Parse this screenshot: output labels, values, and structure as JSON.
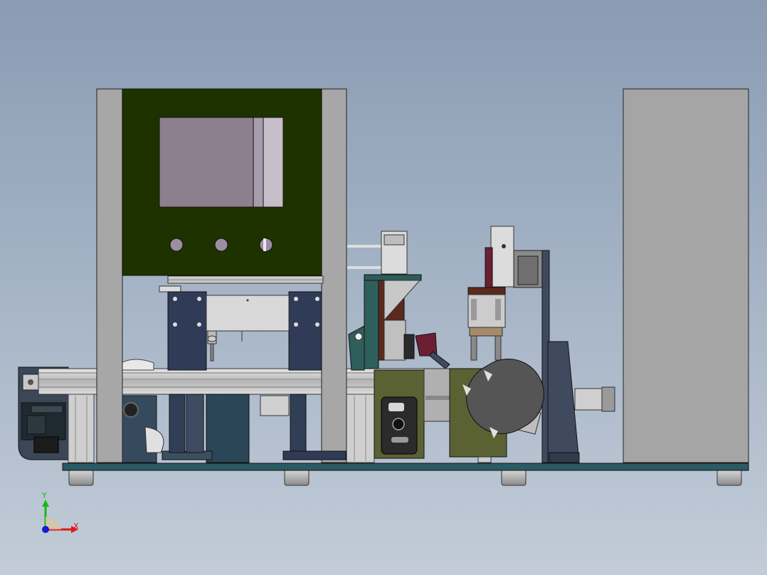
{
  "view": {
    "type": "CAD assembly front view",
    "background_top": "#8a9bb2",
    "background_bottom": "#c2ccd8"
  },
  "triad": {
    "x_label": "X",
    "y_label": "Y",
    "x_color": "#e01818",
    "y_color": "#18b818",
    "z_color": "#1818d8"
  },
  "colors": {
    "frame": "#a7a7a7",
    "panel": "#1e3200",
    "screen": "#8c7f8e",
    "base_plate": "#2a5a63",
    "steel_blue": "#404a5e",
    "olive": "#5a6234",
    "maroon": "#6a1f33",
    "teal": "#2f5f5a"
  }
}
